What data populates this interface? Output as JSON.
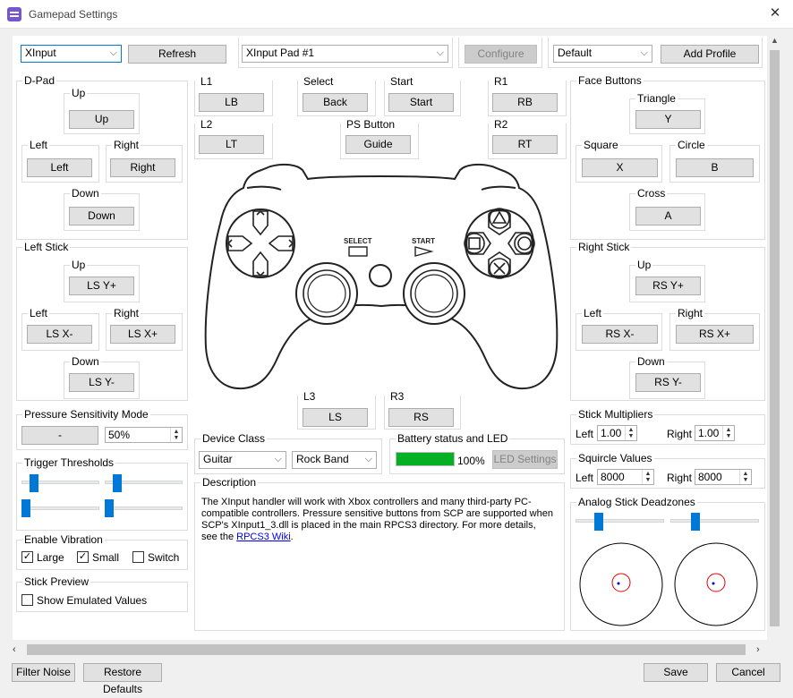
{
  "window": {
    "title": "Gamepad Settings",
    "close_glyph": "✕"
  },
  "top": {
    "handler": "XInput",
    "refresh": "Refresh",
    "device": "XInput Pad #1",
    "configure": "Configure",
    "profile": "Default",
    "add_profile": "Add Profile"
  },
  "dpad": {
    "title": "D-Pad",
    "up_label": "Up",
    "up": "Up",
    "left_label": "Left",
    "left": "Left",
    "right_label": "Right",
    "right": "Right",
    "down_label": "Down",
    "down": "Down"
  },
  "left_stick": {
    "title": "Left Stick",
    "up_label": "Up",
    "up": "LS Y+",
    "left_label": "Left",
    "left": "LS X-",
    "right_label": "Right",
    "right": "LS X+",
    "down_label": "Down",
    "down": "LS Y-"
  },
  "shoulders": {
    "l1_label": "L1",
    "l1": "LB",
    "l2_label": "L2",
    "l2": "LT",
    "r1_label": "R1",
    "r1": "RB",
    "r2_label": "R2",
    "r2": "RT",
    "select_label": "Select",
    "select": "Back",
    "start_label": "Start",
    "start": "Start",
    "ps_label": "PS Button",
    "ps": "Guide",
    "l3_label": "L3",
    "l3": "LS",
    "r3_label": "R3",
    "r3": "RS"
  },
  "controller": {
    "select_text": "SELECT",
    "start_text": "START"
  },
  "face": {
    "title": "Face Buttons",
    "triangle_label": "Triangle",
    "triangle": "Y",
    "square_label": "Square",
    "square": "X",
    "circle_label": "Circle",
    "circle": "B",
    "cross_label": "Cross",
    "cross": "A"
  },
  "right_stick": {
    "title": "Right Stick",
    "up_label": "Up",
    "up": "RS Y+",
    "left_label": "Left",
    "left": "RS X-",
    "right_label": "Right",
    "right": "RS X+",
    "down_label": "Down",
    "down": "RS Y-"
  },
  "pressure": {
    "title": "Pressure Sensitivity Mode",
    "button": "-",
    "value": "50%"
  },
  "trigger": {
    "title": "Trigger Thresholds"
  },
  "vibration": {
    "title": "Enable Vibration",
    "large": "Large",
    "small": "Small",
    "switch": "Switch",
    "large_checked": true,
    "small_checked": true,
    "switch_checked": false
  },
  "stick_preview": {
    "title": "Stick Preview",
    "show": "Show Emulated Values"
  },
  "device_class": {
    "title": "Device Class",
    "class": "Guitar",
    "subclass": "Rock Band"
  },
  "battery": {
    "title": "Battery status and LED",
    "percent": "100%",
    "led": "LED Settings",
    "level": 1.0,
    "color": "#06b025"
  },
  "description": {
    "title": "Description",
    "text": "The XInput handler will work with Xbox controllers and many third-party PC-compatible controllers. Pressure sensitive buttons from SCP are supported when SCP's XInput1_3.dll is placed in the main RPCS3 directory. For more details, see the ",
    "link": "RPCS3 Wiki",
    "tail": "."
  },
  "multipliers": {
    "title": "Stick Multipliers",
    "left_label": "Left",
    "left": "1.00",
    "right_label": "Right",
    "right": "1.00"
  },
  "squircle": {
    "title": "Squircle Values",
    "left_label": "Left",
    "left": "8000",
    "right_label": "Right",
    "right": "8000"
  },
  "deadzones": {
    "title": "Analog Stick Deadzones"
  },
  "footer": {
    "filter": "Filter Noise",
    "restore": "Restore Defaults",
    "save": "Save",
    "cancel": "Cancel"
  },
  "colors": {
    "accent": "#0078d7",
    "deadzone_circle": "#e00000",
    "stick_dot": "#0000cc"
  }
}
